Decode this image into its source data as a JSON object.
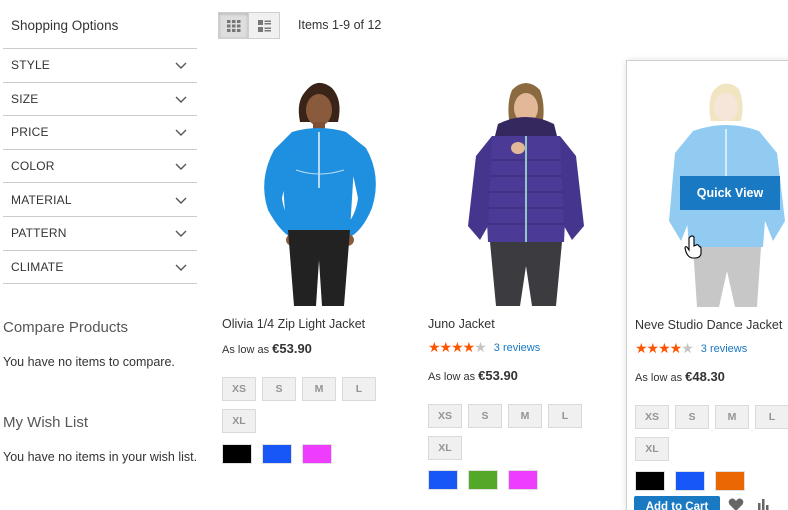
{
  "sidebar": {
    "title": "Shopping Options",
    "filters": [
      {
        "label": "STYLE"
      },
      {
        "label": "SIZE"
      },
      {
        "label": "PRICE"
      },
      {
        "label": "COLOR"
      },
      {
        "label": "MATERIAL"
      },
      {
        "label": "PATTERN"
      },
      {
        "label": "CLIMATE"
      }
    ],
    "compare": {
      "title": "Compare Products",
      "empty_text": "You have no items to compare."
    },
    "wishlist": {
      "title": "My Wish List",
      "empty_text": "You have no items in your wish list."
    }
  },
  "toolbar": {
    "grid_icon": "grid-icon",
    "list_icon": "list-icon",
    "items_text": "Items 1-9 of 12"
  },
  "products": [
    {
      "name": "Olivia 1/4 Zip Light Jacket",
      "price_prefix": "As low as",
      "price": "€53.90",
      "sizes": [
        "XS",
        "S",
        "M",
        "L",
        "XL"
      ],
      "colors": [
        "#000000",
        "#1857f7",
        "#ef3dff"
      ]
    },
    {
      "name": "Juno Jacket",
      "rating": 4,
      "reviews": "3 reviews",
      "price_prefix": "As low as",
      "price": "€53.90",
      "sizes": [
        "XS",
        "S",
        "M",
        "L",
        "XL"
      ],
      "colors": [
        "#1857f7",
        "#53a828",
        "#ef3dff"
      ]
    },
    {
      "name": "Neve Studio Dance Jacket",
      "rating": 4,
      "reviews": "3 reviews",
      "price_prefix": "As low as",
      "price": "€48.30",
      "sizes": [
        "XS",
        "S",
        "M",
        "L",
        "XL"
      ],
      "colors": [
        "#000000",
        "#1857f7",
        "#eb6703"
      ],
      "quick_view": "Quick View",
      "add_to_cart": "Add to Cart"
    }
  ],
  "colors": {
    "accent": "#1979c3",
    "star": "#ff5501"
  }
}
